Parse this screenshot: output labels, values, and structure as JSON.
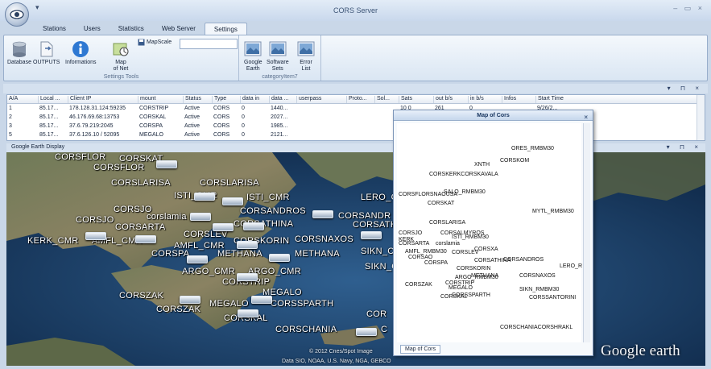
{
  "app": {
    "title": "CORS Server",
    "qat_label": "▾",
    "window_controls": "– ▭ ×"
  },
  "tabs": [
    "Stations",
    "Users",
    "Statistics",
    "Web Server",
    "Settings"
  ],
  "ribbon": {
    "group1": {
      "label": "Settings Tools",
      "buttons": [
        "Database",
        "OUTPUTS",
        "Informations",
        "Map"
      ],
      "map_sublabel": "of Net",
      "mapscale_label": "MapScale",
      "mapscale_value": ""
    },
    "group2": {
      "label": "categoryItem7",
      "buttons": [
        [
          "Google",
          "Earth"
        ],
        [
          "Software",
          "Sets"
        ],
        [
          "Error",
          "List"
        ]
      ]
    }
  },
  "table": {
    "panel_controls": "▾ ⊓ ×",
    "columns": [
      "A/A",
      "Local ...",
      "Client IP",
      "mount",
      "Status",
      "Type",
      "data in",
      "data ...",
      "userpass",
      "Proto...",
      "Sol...",
      "Sats",
      "out b/s",
      "in b/s",
      "Infos",
      "Start Time"
    ],
    "rows": [
      [
        "1",
        "85.17...",
        "178.128.31.124:59235",
        "CORSTRIP",
        "Active",
        "CORS",
        "0",
        "1440...",
        "",
        "",
        "",
        "10 0",
        "261",
        "0",
        "",
        "9/26/2..."
      ],
      [
        "2",
        "85.17...",
        "46.176.69.68:13753",
        "CORSKAL",
        "Active",
        "CORS",
        "0",
        "2027...",
        "",
        "",
        "",
        "",
        "",
        "",
        "",
        ""
      ],
      [
        "3",
        "85.17...",
        "37.6.79.219:2045",
        "CORSPA",
        "Active",
        "CORS",
        "0",
        "1985...",
        "",
        "",
        "",
        "",
        "",
        "",
        "",
        ""
      ],
      [
        "5",
        "85.17...",
        "37.6.126.10 / 52095",
        "MEGALO",
        "Active",
        "CORS",
        "0",
        "2121...",
        "",
        "",
        "",
        "",
        "",
        "",
        "",
        ""
      ]
    ]
  },
  "google_earth": {
    "title": "Google Earth Display",
    "panel_controls": "▾ ⊓ ×",
    "copyright": "© 2012 Cnes/Spot Image",
    "data_credit": "Data SIO, NOAA, U.S. Navy, NGA, GEBCO",
    "logo": "Google earth",
    "labels": [
      {
        "id": "corsflor-a",
        "text": "CORSFLOR"
      },
      {
        "id": "corskat",
        "text": "CORSKAT"
      },
      {
        "id": "corsflor-b",
        "text": "CORSFLOR"
      },
      {
        "id": "corslarisa-a",
        "text": "CORSLARISA"
      },
      {
        "id": "corslarisa-b",
        "text": "CORSLARISA"
      },
      {
        "id": "isti-cmr-a",
        "text": "ISTI_CMR"
      },
      {
        "id": "isti-cmr-b",
        "text": "ISTI_CMR"
      },
      {
        "id": "lero",
        "text": "LERO_C"
      },
      {
        "id": "corsjo-a",
        "text": "CORSJO"
      },
      {
        "id": "corslamia",
        "text": "corslamia"
      },
      {
        "id": "corsandros-a",
        "text": "CORSANDROS"
      },
      {
        "id": "corsandr-b",
        "text": "CORSANDR"
      },
      {
        "id": "corsjo-b",
        "text": "CORSJO"
      },
      {
        "id": "corsarta",
        "text": "CORSARTA"
      },
      {
        "id": "corsathina-a",
        "text": "CORSATHINA"
      },
      {
        "id": "corsathina-b",
        "text": "CORSATHINA"
      },
      {
        "id": "corslev",
        "text": "CORSLEV"
      },
      {
        "id": "kerk-cmr",
        "text": "KERK_CMR"
      },
      {
        "id": "amfl-cmr-a",
        "text": "AMFL_CMR"
      },
      {
        "id": "amfl-cmr-b",
        "text": "AMFL_CMR"
      },
      {
        "id": "corskorin",
        "text": "CORSKORIN"
      },
      {
        "id": "corsnaxos",
        "text": "CORSNAXOS"
      },
      {
        "id": "corspa",
        "text": "CORSPA"
      },
      {
        "id": "methana-a",
        "text": "METHANA"
      },
      {
        "id": "methana-b",
        "text": "METHANA"
      },
      {
        "id": "sikn-cm-a",
        "text": "SIKN_CM"
      },
      {
        "id": "sikn-cm-b",
        "text": "SIKN_CM"
      },
      {
        "id": "argo-cmr-a",
        "text": "ARGO_CMR"
      },
      {
        "id": "argo-cmr-b",
        "text": "ARGO_CMR"
      },
      {
        "id": "corstrip",
        "text": "CORSTRIP"
      },
      {
        "id": "megalo-a",
        "text": "MEGALO"
      },
      {
        "id": "megalo-b",
        "text": "MEGALO"
      },
      {
        "id": "corszak-a",
        "text": "CORSZAK"
      },
      {
        "id": "corszak-b",
        "text": "CORSZAK"
      },
      {
        "id": "corssparth",
        "text": "CORSSPARTH"
      },
      {
        "id": "corskal",
        "text": "CORSKAL"
      },
      {
        "id": "cors-edge",
        "text": "COR"
      },
      {
        "id": "corschania",
        "text": "CORSCHANIA"
      },
      {
        "id": "cc-edge",
        "text": "C"
      }
    ]
  },
  "map_window": {
    "title": "Map of Cors",
    "close": "×",
    "tab": "Map of Cors",
    "points": [
      {
        "id": "ores",
        "text": "ORES_RMBM30"
      },
      {
        "id": "corskom",
        "text": "CORSKOM"
      },
      {
        "id": "xnth",
        "text": "XNTH"
      },
      {
        "id": "corskerk",
        "text": "CORSKERKCORSKAVALA"
      },
      {
        "id": "salo",
        "text": "SALO_RMBM30"
      },
      {
        "id": "corsflor",
        "text": "CORSFLORSNAOUSA"
      },
      {
        "id": "corskat",
        "text": "CORSKAT"
      },
      {
        "id": "mytl",
        "text": "MYTL_RMBM30"
      },
      {
        "id": "corslarisa",
        "text": "CORSLARISA"
      },
      {
        "id": "corsjo",
        "text": "CORSJO"
      },
      {
        "id": "corsalmyros",
        "text": "CORSALMYROS"
      },
      {
        "id": "kerk",
        "text": "KERK"
      },
      {
        "id": "isti",
        "text": "ISTI_RMBM30"
      },
      {
        "id": "corsarta",
        "text": "CORSARTA"
      },
      {
        "id": "corslamia",
        "text": "corslamia"
      },
      {
        "id": "corsxa",
        "text": "CORSXA"
      },
      {
        "id": "amfl",
        "text": "AMFL_RMBM30"
      },
      {
        "id": "corslev",
        "text": "CORSLEV"
      },
      {
        "id": "corsao",
        "text": "CORSAO"
      },
      {
        "id": "corsathina",
        "text": "CORSATHINA"
      },
      {
        "id": "corsandros",
        "text": "CORSANDROS"
      },
      {
        "id": "lero",
        "text": "LERO_R"
      },
      {
        "id": "corspa",
        "text": "CORSPA"
      },
      {
        "id": "corskorin",
        "text": "CORSKORIN"
      },
      {
        "id": "argo",
        "text": "ARGO_RMBM30"
      },
      {
        "id": "methana",
        "text": "METHANA"
      },
      {
        "id": "corsnaxos",
        "text": "CORSNAXOS"
      },
      {
        "id": "corszak",
        "text": "CORSZAK"
      },
      {
        "id": "corstrip",
        "text": "CORSTRIP"
      },
      {
        "id": "megalo",
        "text": "MEGALO"
      },
      {
        "id": "sikn",
        "text": "SIKN_RMBM30"
      },
      {
        "id": "corskal",
        "text": "CORSKAL"
      },
      {
        "id": "corssparth",
        "text": "CORSSPARTH"
      },
      {
        "id": "corssantorini",
        "text": "CORSSANTORINI"
      },
      {
        "id": "corschania",
        "text": "CORSCHANIACORSHRAKL"
      }
    ]
  }
}
